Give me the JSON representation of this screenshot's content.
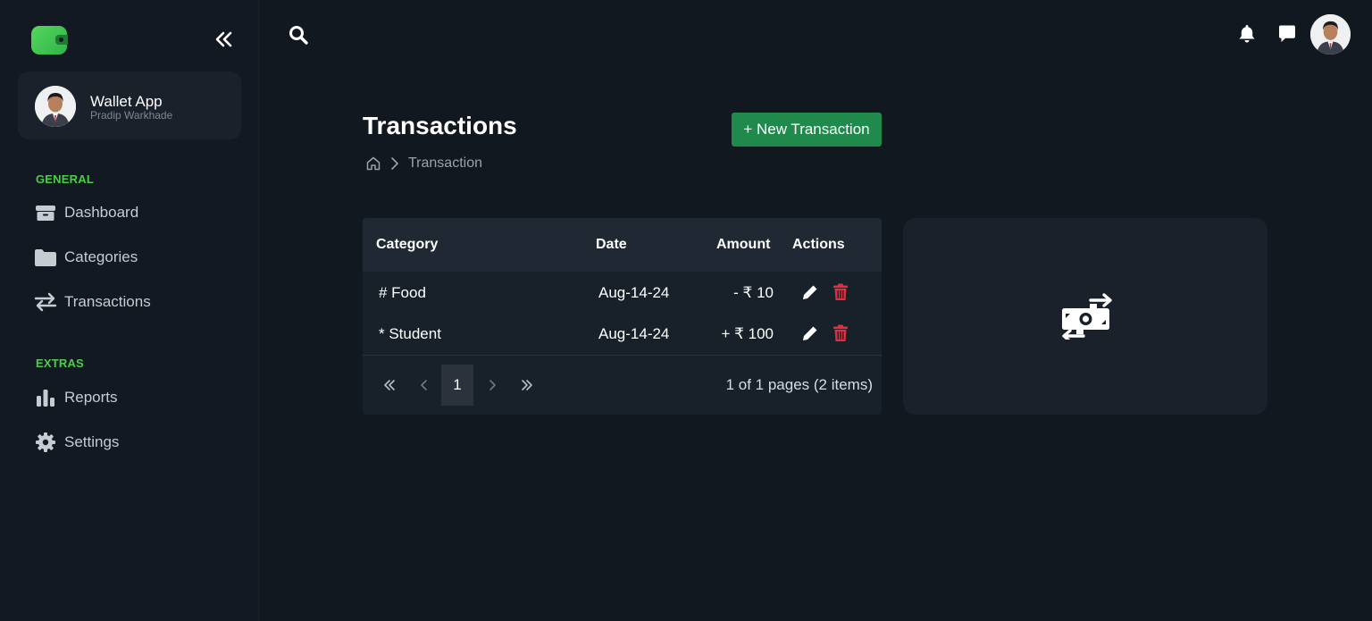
{
  "app": {
    "name": "Wallet App",
    "user": "Pradip Warkhade"
  },
  "sidebar": {
    "sections": [
      {
        "label": "GENERAL",
        "items": [
          {
            "label": "Dashboard",
            "icon": "box-icon"
          },
          {
            "label": "Categories",
            "icon": "folder-icon"
          },
          {
            "label": "Transactions",
            "icon": "transfer-arrows-icon"
          }
        ]
      },
      {
        "label": "EXTRAS",
        "items": [
          {
            "label": "Reports",
            "icon": "bar-chart-icon"
          },
          {
            "label": "Settings",
            "icon": "gear-icon"
          }
        ]
      }
    ]
  },
  "header": {
    "icons": [
      "search-icon",
      "bell-icon",
      "chat-icon",
      "avatar"
    ]
  },
  "page": {
    "title": "Transactions",
    "breadcrumb": "Transaction",
    "new_button": "+ New Transaction"
  },
  "table": {
    "columns": [
      "Category",
      "Date",
      "Amount",
      "Actions"
    ],
    "rows": [
      {
        "category": "# Food",
        "date": "Aug-14-24",
        "amount": "- ₹ 10"
      },
      {
        "category": "* Student",
        "date": "Aug-14-24",
        "amount": "+ ₹ 100"
      }
    ],
    "pager": {
      "current": "1",
      "info": "1 of 1 pages (2 items)"
    }
  },
  "colors": {
    "background": "#111820",
    "sidebar": "#131922",
    "accent_green": "#4ccd4a",
    "button_green": "#1f8a4c",
    "delete_red": "#e0303f"
  }
}
